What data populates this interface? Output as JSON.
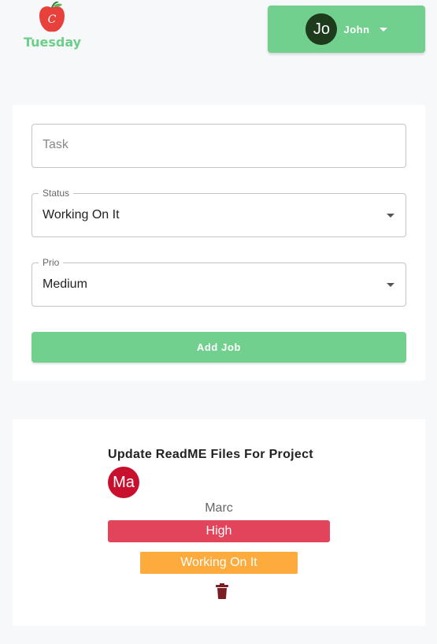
{
  "app": {
    "logo_text": "Tuesday",
    "logo_icon": "apple-icon",
    "brand_color": "#72d08e"
  },
  "user_menu": {
    "avatar_initials": "Jo",
    "name": "John",
    "icon": "chevron-down-icon"
  },
  "form": {
    "task_placeholder": "Task",
    "task_value": "",
    "status_label": "Status",
    "status_value": "Working On It",
    "prio_label": "Prio",
    "prio_value": "Medium",
    "add_button_label": "Add Job"
  },
  "jobs": [
    {
      "title": "Update ReadME Files For Project",
      "owner_initials": "Ma",
      "owner_name": "Marc",
      "priority": "High",
      "priority_color": "#e2445c",
      "status": "Working On It",
      "status_color": "#fdab3d",
      "delete_icon": "trash-icon"
    }
  ]
}
